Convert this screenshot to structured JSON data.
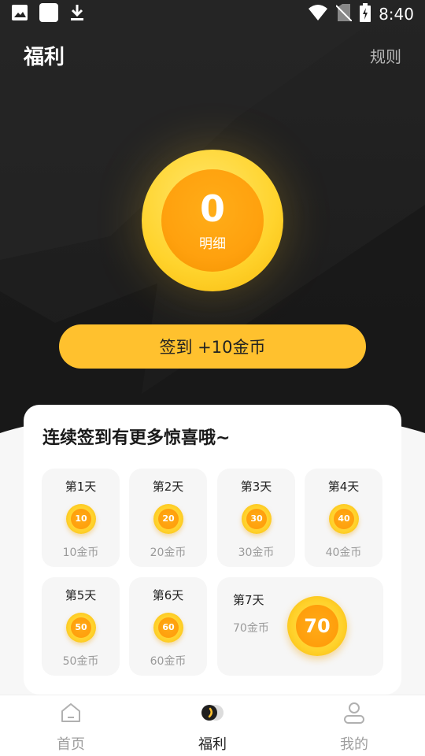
{
  "status_bar": {
    "time": "8:40",
    "icons_left": [
      "image-icon",
      "square-icon",
      "download-icon"
    ],
    "icons_right": [
      "wifi-icon",
      "no-sim-icon",
      "battery-charging-icon"
    ]
  },
  "header": {
    "title": "福利",
    "rules_label": "规则"
  },
  "coin_balance": {
    "value": "0",
    "detail_label": "明细"
  },
  "signin_button": {
    "label": "签到 +10金币"
  },
  "streak_card": {
    "title": "连续签到有更多惊喜哦~",
    "days": [
      {
        "label": "第1天",
        "coin": "10",
        "reward": "10金币"
      },
      {
        "label": "第2天",
        "coin": "20",
        "reward": "20金币"
      },
      {
        "label": "第3天",
        "coin": "30",
        "reward": "30金币"
      },
      {
        "label": "第4天",
        "coin": "40",
        "reward": "40金币"
      },
      {
        "label": "第5天",
        "coin": "50",
        "reward": "50金币"
      },
      {
        "label": "第6天",
        "coin": "60",
        "reward": "60金币"
      },
      {
        "label": "第7天",
        "coin": "70",
        "reward": "70金币"
      }
    ]
  },
  "bottom_nav": {
    "items": [
      {
        "label": "首页",
        "icon": "home-icon",
        "active": false
      },
      {
        "label": "福利",
        "icon": "coin-toggle-icon",
        "active": true
      },
      {
        "label": "我的",
        "icon": "profile-icon",
        "active": false
      }
    ]
  },
  "colors": {
    "accent": "#ffc12e",
    "coin_outer": "#ffd32c",
    "coin_inner": "#ffa10e",
    "dark_bg": "#1e1e1e"
  }
}
